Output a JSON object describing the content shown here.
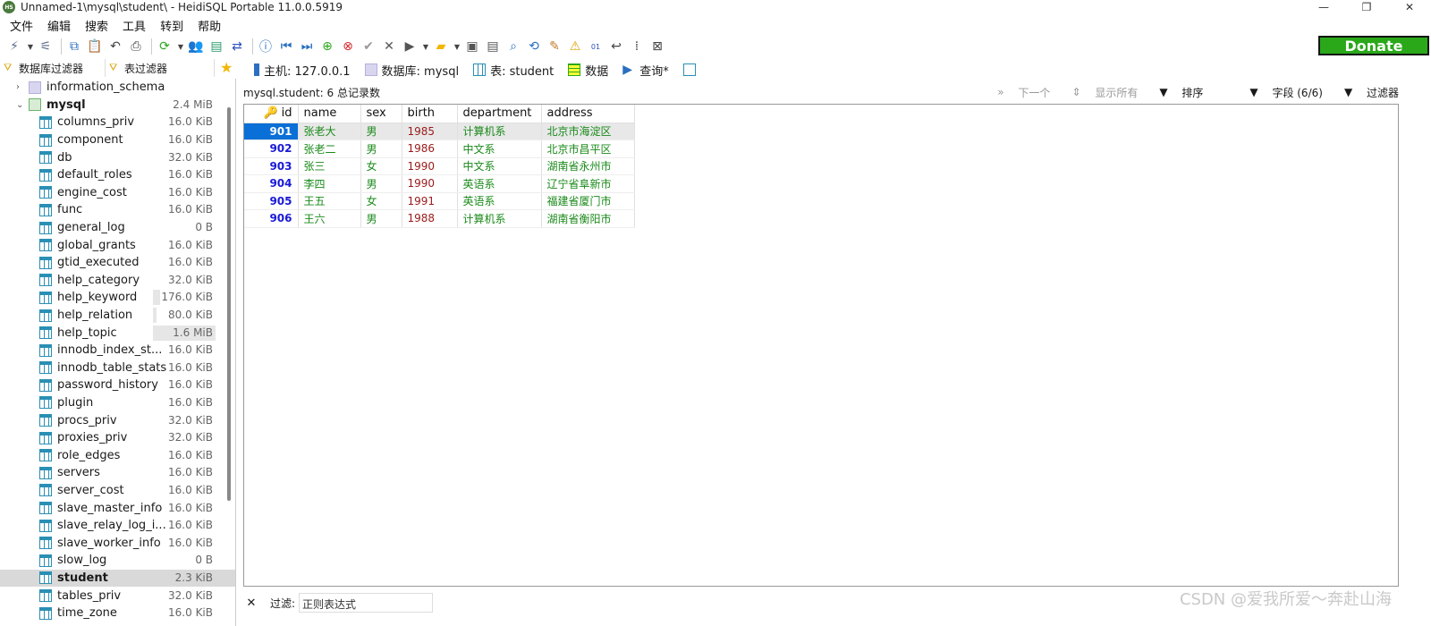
{
  "window": {
    "title": "Unnamed-1\\mysql\\student\\ - HeidiSQL Portable 11.0.0.5919",
    "app_icon_text": "HS",
    "minimize_glyph": "—",
    "maximize_glyph": "❐",
    "close_glyph": "✕"
  },
  "menu": [
    "文件",
    "编辑",
    "搜索",
    "工具",
    "转到",
    "帮助"
  ],
  "toolbar": {
    "donate_label": "Donate",
    "buttons": [
      "connect-icon",
      "dropdown-icon",
      "disconnect-icon",
      "copy-icon",
      "paste-icon",
      "undo-icon",
      "print-icon",
      "refresh-icon",
      "dropdown-icon",
      "user-manager-icon",
      "export-icon",
      "sync-icon",
      "help-icon",
      "first-icon",
      "last-icon",
      "add-icon",
      "delete-icon",
      "apply-icon",
      "cancel-icon",
      "run-icon",
      "dropdown-icon",
      "open-folder-icon",
      "dropdown-icon",
      "save-icon",
      "save-as-icon",
      "find-icon",
      "replace-icon",
      "clean-icon",
      "warning-icon",
      "binary-icon",
      "wrap-icon",
      "comment-icon",
      "close-tab-icon"
    ]
  },
  "filters": {
    "db_filter_label": "数据库过滤器",
    "table_filter_label": "表过滤器"
  },
  "tabs": [
    {
      "label": "主机: 127.0.0.1",
      "icon": "host-icon"
    },
    {
      "label": "数据库: mysql",
      "icon": "database-icon"
    },
    {
      "label": "表: student",
      "icon": "table-icon"
    },
    {
      "label": "数据",
      "icon": "data-grid-icon"
    },
    {
      "label": "查询*",
      "icon": "query-icon"
    },
    {
      "label": "",
      "icon": "new-query-icon"
    }
  ],
  "tree": {
    "databases": [
      {
        "name": "information_schema",
        "expanded": false,
        "size": ""
      },
      {
        "name": "mysql",
        "expanded": true,
        "size": "2.4 MiB"
      }
    ],
    "tables": [
      {
        "name": "columns_priv",
        "size": "16.0 KiB",
        "bar": 0.0
      },
      {
        "name": "component",
        "size": "16.0 KiB",
        "bar": 0.0
      },
      {
        "name": "db",
        "size": "32.0 KiB",
        "bar": 0.0
      },
      {
        "name": "default_roles",
        "size": "16.0 KiB",
        "bar": 0.0
      },
      {
        "name": "engine_cost",
        "size": "16.0 KiB",
        "bar": 0.0
      },
      {
        "name": "func",
        "size": "16.0 KiB",
        "bar": 0.0
      },
      {
        "name": "general_log",
        "size": "0 B",
        "bar": 0.0
      },
      {
        "name": "global_grants",
        "size": "16.0 KiB",
        "bar": 0.0
      },
      {
        "name": "gtid_executed",
        "size": "16.0 KiB",
        "bar": 0.0
      },
      {
        "name": "help_category",
        "size": "32.0 KiB",
        "bar": 0.0
      },
      {
        "name": "help_keyword",
        "size": "176.0 KiB",
        "bar": 0.11
      },
      {
        "name": "help_relation",
        "size": "80.0 KiB",
        "bar": 0.05
      },
      {
        "name": "help_topic",
        "size": "1.6 MiB",
        "bar": 1.0
      },
      {
        "name": "innodb_index_st...",
        "size": "16.0 KiB",
        "bar": 0.0
      },
      {
        "name": "innodb_table_stats",
        "size": "16.0 KiB",
        "bar": 0.0
      },
      {
        "name": "password_history",
        "size": "16.0 KiB",
        "bar": 0.0
      },
      {
        "name": "plugin",
        "size": "16.0 KiB",
        "bar": 0.0
      },
      {
        "name": "procs_priv",
        "size": "32.0 KiB",
        "bar": 0.0
      },
      {
        "name": "proxies_priv",
        "size": "32.0 KiB",
        "bar": 0.0
      },
      {
        "name": "role_edges",
        "size": "16.0 KiB",
        "bar": 0.0
      },
      {
        "name": "servers",
        "size": "16.0 KiB",
        "bar": 0.0
      },
      {
        "name": "server_cost",
        "size": "16.0 KiB",
        "bar": 0.0
      },
      {
        "name": "slave_master_info",
        "size": "16.0 KiB",
        "bar": 0.0
      },
      {
        "name": "slave_relay_log_i...",
        "size": "16.0 KiB",
        "bar": 0.0
      },
      {
        "name": "slave_worker_info",
        "size": "16.0 KiB",
        "bar": 0.0
      },
      {
        "name": "slow_log",
        "size": "0 B",
        "bar": 0.0
      },
      {
        "name": "student",
        "size": "2.3 KiB",
        "bar": 0.0,
        "selected": true
      },
      {
        "name": "tables_priv",
        "size": "32.0 KiB",
        "bar": 0.0
      },
      {
        "name": "time_zone",
        "size": "16.0 KiB",
        "bar": 0.0
      }
    ]
  },
  "data_view": {
    "summary": "mysql.student: 6 总记录数",
    "next_label": "下一个",
    "show_all_label": "显示所有",
    "sort_label": "排序",
    "fields_label": "字段 (6/6)",
    "filter_label": "过滤器",
    "columns": [
      "id",
      "name",
      "sex",
      "birth",
      "department",
      "address"
    ],
    "rows": [
      [
        "901",
        "张老大",
        "男",
        "1985",
        "计算机系",
        "北京市海淀区"
      ],
      [
        "902",
        "张老二",
        "男",
        "1986",
        "中文系",
        "北京市昌平区"
      ],
      [
        "903",
        "张三",
        "女",
        "1990",
        "中文系",
        "湖南省永州市"
      ],
      [
        "904",
        "李四",
        "男",
        "1990",
        "英语系",
        "辽宁省阜新市"
      ],
      [
        "905",
        "王五",
        "女",
        "1991",
        "英语系",
        "福建省厦门市"
      ],
      [
        "906",
        "王六",
        "男",
        "1988",
        "计算机系",
        "湖南省衡阳市"
      ]
    ]
  },
  "bottom_filter": {
    "label": "过滤:",
    "placeholder": "正则表达式"
  },
  "watermark": "CSDN @爱我所爱～奔赴山海",
  "colors": {
    "donate": "#2aa81a",
    "highlight": "#ffff33",
    "selected_id_cell": "#0a6fd6",
    "id_text": "#1a1ad6",
    "text_value": "#1a8a1a",
    "number_value": "#9a1a1a"
  }
}
